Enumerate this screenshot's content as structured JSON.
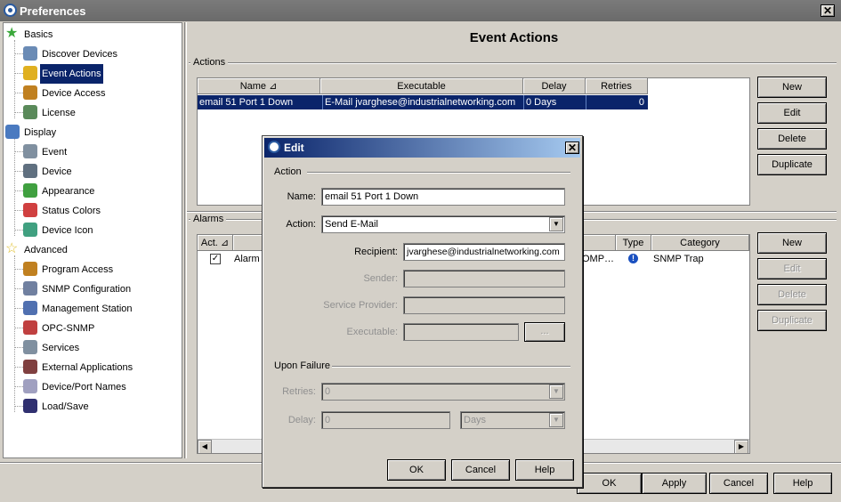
{
  "window": {
    "title": "Preferences",
    "close_glyph": "✕"
  },
  "tree": {
    "items": [
      {
        "label": "Basics",
        "icon": "star-icon",
        "color": "#3aa83a"
      },
      {
        "label": "Discover Devices",
        "icon": "magnifier-icon",
        "color": "#6a8bb5"
      },
      {
        "label": "Event Actions",
        "icon": "pencil-icon",
        "color": "#e0b020"
      },
      {
        "label": "Device Access",
        "icon": "key-icon",
        "color": "#c08020"
      },
      {
        "label": "License",
        "icon": "license-icon",
        "color": "#5a8a5a"
      },
      {
        "label": "Display",
        "icon": "display-icon",
        "color": "#4a7ac0"
      },
      {
        "label": "Event",
        "icon": "event-icon",
        "color": "#8090a0"
      },
      {
        "label": "Device",
        "icon": "device-icon",
        "color": "#607080"
      },
      {
        "label": "Appearance",
        "icon": "appearance-icon",
        "color": "#40a040"
      },
      {
        "label": "Status Colors",
        "icon": "status-colors-icon",
        "color": "#d04040"
      },
      {
        "label": "Device Icon",
        "icon": "device-icon-icon",
        "color": "#40a080"
      },
      {
        "label": "Advanced",
        "icon": "star-outline-icon",
        "color": "#e0c030"
      },
      {
        "label": "Program Access",
        "icon": "program-access-icon",
        "color": "#c08020"
      },
      {
        "label": "SNMP Configuration",
        "icon": "snmp-icon",
        "color": "#7080a0"
      },
      {
        "label": "Management Station",
        "icon": "station-icon",
        "color": "#5070b0"
      },
      {
        "label": "OPC-SNMP",
        "icon": "opc-icon",
        "color": "#c04040"
      },
      {
        "label": "Services",
        "icon": "services-icon",
        "color": "#8090a0"
      },
      {
        "label": "External Applications",
        "icon": "books-icon",
        "color": "#804040"
      },
      {
        "label": "Device/Port Names",
        "icon": "speech-icon",
        "color": "#a0a0c0"
      },
      {
        "label": "Load/Save",
        "icon": "floppy-icon",
        "color": "#303070"
      }
    ]
  },
  "main": {
    "title": "Event Actions",
    "actions_group": "Actions",
    "actions_columns": [
      "Name",
      "Executable",
      "Delay",
      "Retries"
    ],
    "sort_glyph": "⊿",
    "actions_rows": [
      {
        "name": "email 51 Port 1 Down",
        "executable": "E-Mail jvarghese@industrialnetworking.com",
        "delay": "0 Days",
        "retries": "0"
      }
    ],
    "actions_buttons": [
      "New",
      "Edit",
      "Delete",
      "Duplicate"
    ],
    "alarms_group": "Alarms",
    "alarms_columns": [
      "Act.",
      "Type",
      "Category"
    ],
    "alarms_rows": [
      {
        "act": "✓",
        "name": "Alarm",
        "mid": "OMP…",
        "type": "!",
        "category": "SNMP Trap"
      }
    ],
    "alarms_buttons": [
      "New",
      "Edit",
      "Delete",
      "Duplicate"
    ],
    "footer_buttons": [
      "OK",
      "Apply",
      "Cancel",
      "Help"
    ]
  },
  "dialog": {
    "title": "Edit",
    "action_group": "Action",
    "name_label": "Name:",
    "name_value": "email 51 Port 1 Down",
    "action_label": "Action:",
    "action_value": "Send E-Mail",
    "recipient_label": "Recipient:",
    "recipient_value": "jvarghese@industrialnetworking.com",
    "sender_label": "Sender:",
    "provider_label": "Service Provider:",
    "exec_label": "Executable:",
    "browse_label": "...",
    "failure_group": "Upon Failure",
    "retries_label": "Retries:",
    "retries_value": "0",
    "delay_label": "Delay:",
    "delay_value": "0",
    "delay_unit": "Days",
    "buttons": [
      "OK",
      "Cancel",
      "Help"
    ]
  }
}
